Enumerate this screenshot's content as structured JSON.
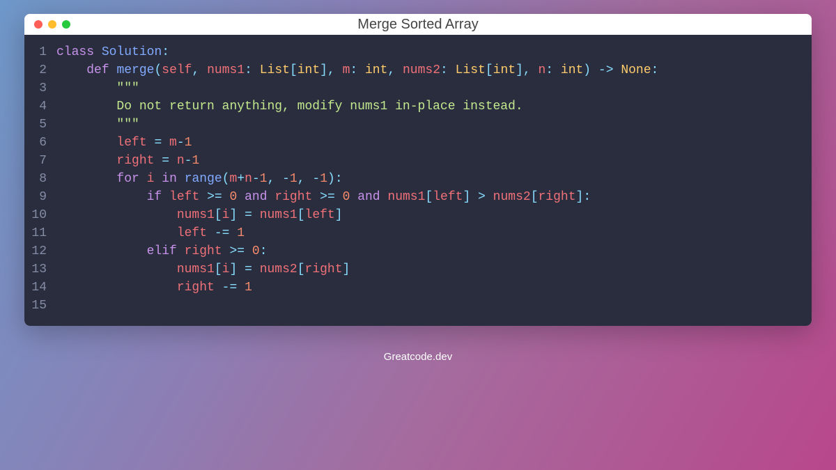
{
  "window": {
    "title": "Merge Sorted Array"
  },
  "caption": "Greatcode.dev",
  "line_numbers": [
    "1",
    "2",
    "3",
    "4",
    "5",
    "6",
    "7",
    "8",
    "9",
    "10",
    "11",
    "12",
    "13",
    "14",
    "15"
  ],
  "code": {
    "l1": {
      "t1": "class",
      "t2": " ",
      "t3": "Solution",
      "t4": ":"
    },
    "l2": {
      "t1": "    ",
      "t2": "def",
      "t3": " ",
      "t4": "merge",
      "t5": "(",
      "t6": "self",
      "t7": ", ",
      "t8": "nums1",
      "t9": ": ",
      "t10": "List",
      "t11": "[",
      "t12": "int",
      "t13": "], ",
      "t14": "m",
      "t15": ": ",
      "t16": "int",
      "t17": ", ",
      "t18": "nums2",
      "t19": ": ",
      "t20": "List",
      "t21": "[",
      "t22": "int",
      "t23": "], ",
      "t24": "n",
      "t25": ": ",
      "t26": "int",
      "t27": ") -> ",
      "t28": "None",
      "t29": ":"
    },
    "l3": {
      "t1": "        ",
      "t2": "\"\"\""
    },
    "l4": {
      "t1": "        ",
      "t2": "Do not return anything, modify nums1 in-place instead."
    },
    "l5": {
      "t1": "        ",
      "t2": "\"\"\""
    },
    "l6": {
      "t1": "        ",
      "t2": "left",
      "t3": " = ",
      "t4": "m",
      "t5": "-",
      "t6": "1"
    },
    "l7": {
      "t1": "        ",
      "t2": "right",
      "t3": " = ",
      "t4": "n",
      "t5": "-",
      "t6": "1"
    },
    "l8": {
      "t1": "        ",
      "t2": "for",
      "t3": " ",
      "t4": "i",
      "t5": " ",
      "t6": "in",
      "t7": " ",
      "t8": "range",
      "t9": "(",
      "t10": "m",
      "t11": "+",
      "t12": "n",
      "t13": "-",
      "t14": "1",
      "t15": ", -",
      "t16": "1",
      "t17": ", -",
      "t18": "1",
      "t19": "):"
    },
    "l9": {
      "t1": "            ",
      "t2": "if",
      "t3": " ",
      "t4": "left",
      "t5": " >= ",
      "t6": "0",
      "t7": " ",
      "t8": "and",
      "t9": " ",
      "t10": "right",
      "t11": " >= ",
      "t12": "0",
      "t13": " ",
      "t14": "and",
      "t15": " ",
      "t16": "nums1",
      "t17": "[",
      "t18": "left",
      "t19": "] > ",
      "t20": "nums2",
      "t21": "[",
      "t22": "right",
      "t23": "]:"
    },
    "l10": {
      "t1": "                ",
      "t2": "nums1",
      "t3": "[",
      "t4": "i",
      "t5": "] = ",
      "t6": "nums1",
      "t7": "[",
      "t8": "left",
      "t9": "]"
    },
    "l11": {
      "t1": "                ",
      "t2": "left",
      "t3": " -= ",
      "t4": "1"
    },
    "l12": {
      "t1": "            ",
      "t2": "elif",
      "t3": " ",
      "t4": "right",
      "t5": " >= ",
      "t6": "0",
      "t7": ":"
    },
    "l13": {
      "t1": "                ",
      "t2": "nums1",
      "t3": "[",
      "t4": "i",
      "t5": "] = ",
      "t6": "nums2",
      "t7": "[",
      "t8": "right",
      "t9": "]"
    },
    "l14": {
      "t1": "                ",
      "t2": "right",
      "t3": " -= ",
      "t4": "1"
    },
    "l15": {
      "t1": ""
    }
  }
}
